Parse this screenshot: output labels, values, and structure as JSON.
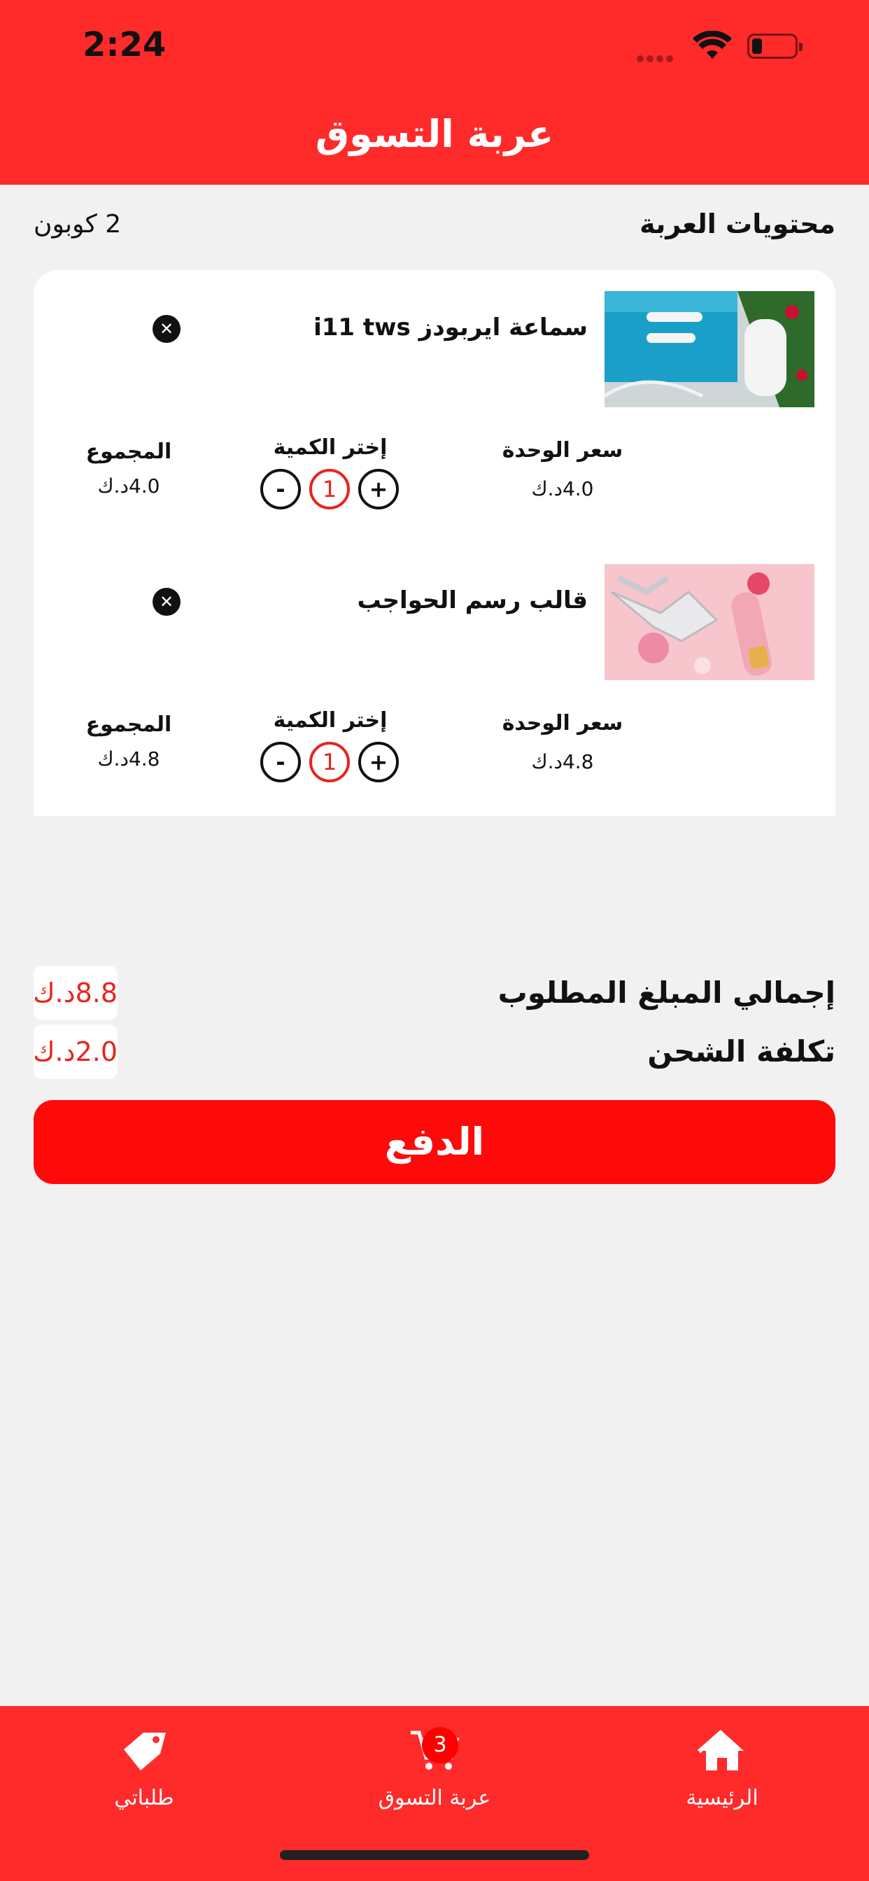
{
  "status_bar": {
    "time": "2:24"
  },
  "header": {
    "title": "عربة التسوق"
  },
  "cart": {
    "contents_title": "محتويات العربة",
    "coupon_label": "2 كوبون",
    "columns": {
      "unit_price": "سعر الوحدة",
      "quantity": "إختر الكمية",
      "total": "المجموع"
    },
    "items": [
      {
        "name": "سماعة ايربودز i11 tws",
        "unit_price": "4.0د.ك",
        "quantity": "1",
        "total": "4.0د.ك",
        "image": "earbuds-product-photo"
      },
      {
        "name": "قالب رسم الحواجب",
        "unit_price": "4.8د.ك",
        "quantity": "1",
        "total": "4.8د.ك",
        "image": "eyebrow-stencil-product-photo"
      }
    ],
    "qty_minus": "-",
    "qty_plus": "+",
    "remove_symbol": "✕"
  },
  "totals": {
    "required_amount_label": "إجمالي المبلغ المطلوب",
    "required_amount_value": "8.8د.ك",
    "shipping_label": "تكلفة الشحن",
    "shipping_value": "2.0د.ك"
  },
  "pay_button": "الدفع",
  "bottom_nav": {
    "items": [
      {
        "label": "الرئيسية",
        "icon": "home-icon"
      },
      {
        "label": "عربة التسوق",
        "icon": "cart-icon",
        "badge": "3"
      },
      {
        "label": "طلباتي",
        "icon": "tag-icon"
      }
    ]
  },
  "colors": {
    "brand_red": "#ff2a2a",
    "price_red": "#e8241c",
    "pay_red": "#ff0a0a",
    "background": "#f1f1f1"
  }
}
